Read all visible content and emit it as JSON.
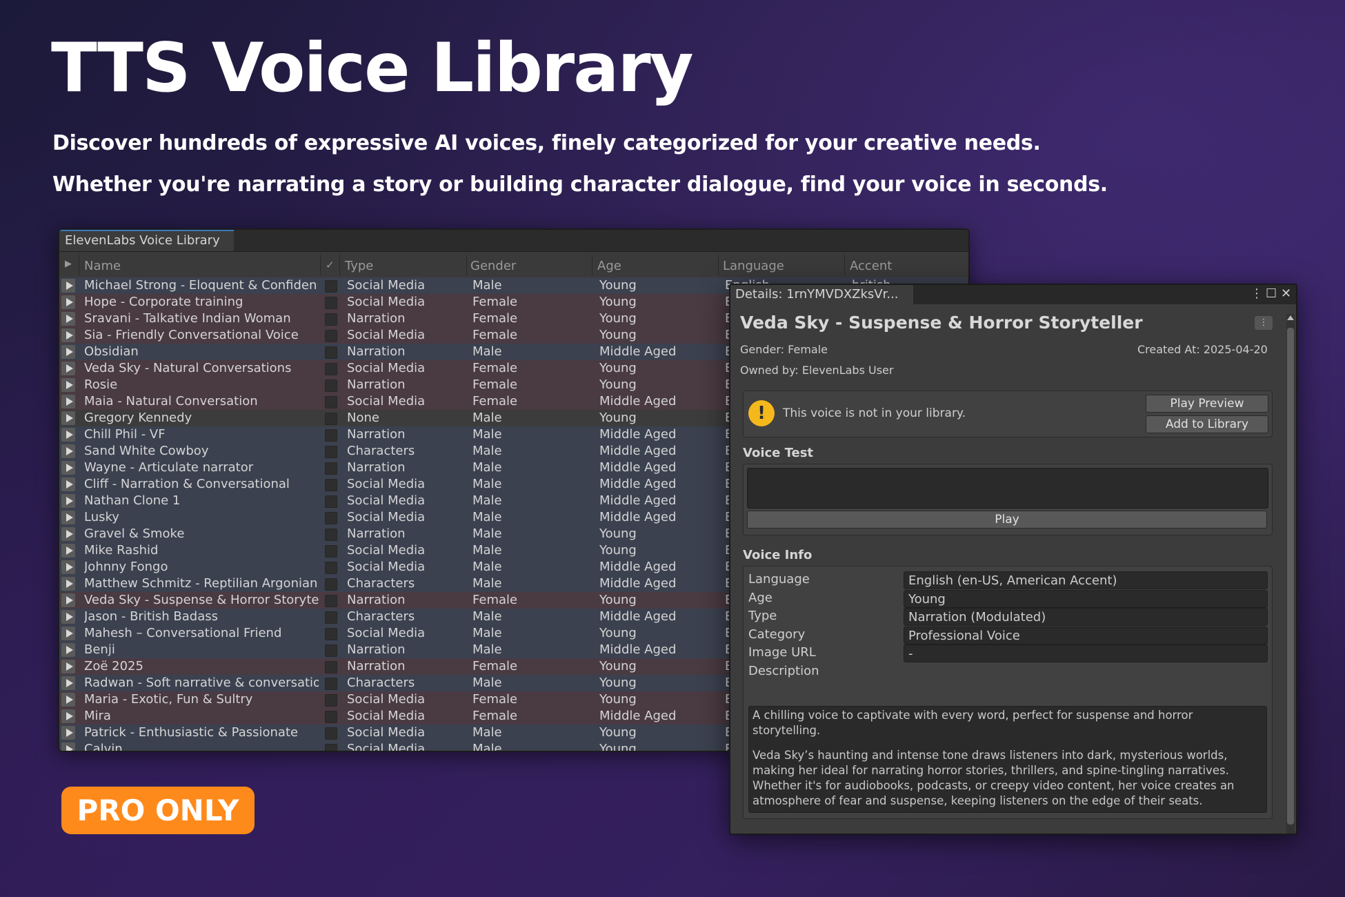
{
  "hero": {
    "title": "TTS Voice Library",
    "line1": "Discover hundreds of expressive AI voices, finely categorized for your creative needs.",
    "line2": "Whether you're narrating a story or building character dialogue, find your voice in seconds.",
    "badge": "PRO ONLY"
  },
  "library": {
    "tab_title": "ElevenLabs Voice Library",
    "columns": {
      "expand": "▶",
      "name": "Name",
      "check": "✓",
      "type": "Type",
      "gender": "Gender",
      "age": "Age",
      "language": "Language",
      "accent": "Accent"
    },
    "rows": [
      {
        "name": "Michael Strong - Eloquent & Confiden",
        "type": "Social Media",
        "gender": "Male",
        "age": "Young",
        "lang": "English",
        "acc": "british"
      },
      {
        "name": "Hope - Corporate training",
        "type": "Social Media",
        "gender": "Female",
        "age": "Young",
        "lang": "E",
        "acc": ""
      },
      {
        "name": "Sravani - Talkative Indian Woman",
        "type": "Narration",
        "gender": "Female",
        "age": "Young",
        "lang": "E",
        "acc": ""
      },
      {
        "name": "Sia - Friendly Conversational Voice",
        "type": "Social Media",
        "gender": "Female",
        "age": "Young",
        "lang": "E",
        "acc": ""
      },
      {
        "name": "Obsidian",
        "type": "Narration",
        "gender": "Male",
        "age": "Middle Aged",
        "lang": "E",
        "acc": ""
      },
      {
        "name": "Veda Sky - Natural Conversations",
        "type": "Social Media",
        "gender": "Female",
        "age": "Young",
        "lang": "E",
        "acc": ""
      },
      {
        "name": "Rosie",
        "type": "Narration",
        "gender": "Female",
        "age": "Young",
        "lang": "E",
        "acc": ""
      },
      {
        "name": "Maia - Natural Conversation",
        "type": "Social Media",
        "gender": "Female",
        "age": "Middle Aged",
        "lang": "E",
        "acc": ""
      },
      {
        "name": "Gregory Kennedy",
        "type": "None",
        "gender": "Male",
        "age": "Young",
        "lang": "E",
        "acc": ""
      },
      {
        "name": "Chill Phil - VF",
        "type": "Narration",
        "gender": "Male",
        "age": "Middle Aged",
        "lang": "E",
        "acc": ""
      },
      {
        "name": "Sand White Cowboy",
        "type": "Characters",
        "gender": "Male",
        "age": "Middle Aged",
        "lang": "E",
        "acc": ""
      },
      {
        "name": "Wayne - Articulate narrator",
        "type": "Narration",
        "gender": "Male",
        "age": "Middle Aged",
        "lang": "E",
        "acc": ""
      },
      {
        "name": "Cliff - Narration & Conversational",
        "type": "Social Media",
        "gender": "Male",
        "age": "Middle Aged",
        "lang": "E",
        "acc": ""
      },
      {
        "name": "Nathan Clone 1",
        "type": "Social Media",
        "gender": "Male",
        "age": "Middle Aged",
        "lang": "E",
        "acc": ""
      },
      {
        "name": "Lusky",
        "type": "Social Media",
        "gender": "Male",
        "age": "Middle Aged",
        "lang": "E",
        "acc": ""
      },
      {
        "name": "Gravel & Smoke",
        "type": "Narration",
        "gender": "Male",
        "age": "Young",
        "lang": "E",
        "acc": ""
      },
      {
        "name": "Mike Rashid",
        "type": "Social Media",
        "gender": "Male",
        "age": "Young",
        "lang": "E",
        "acc": ""
      },
      {
        "name": "Johnny Fongo",
        "type": "Social Media",
        "gender": "Male",
        "age": "Middle Aged",
        "lang": "E",
        "acc": ""
      },
      {
        "name": "Matthew Schmitz - Reptilian Argonian",
        "type": "Characters",
        "gender": "Male",
        "age": "Middle Aged",
        "lang": "E",
        "acc": ""
      },
      {
        "name": "Veda Sky - Suspense & Horror Storyte",
        "type": "Narration",
        "gender": "Female",
        "age": "Young",
        "lang": "E",
        "acc": ""
      },
      {
        "name": "Jason - British Badass",
        "type": "Characters",
        "gender": "Male",
        "age": "Middle Aged",
        "lang": "E",
        "acc": ""
      },
      {
        "name": "Mahesh – Conversational Friend",
        "type": "Social Media",
        "gender": "Male",
        "age": "Young",
        "lang": "E",
        "acc": ""
      },
      {
        "name": "Benji",
        "type": "Narration",
        "gender": "Male",
        "age": "Middle Aged",
        "lang": "E",
        "acc": ""
      },
      {
        "name": "Zoë 2025",
        "type": "Narration",
        "gender": "Female",
        "age": "Young",
        "lang": "E",
        "acc": ""
      },
      {
        "name": "Radwan - Soft narrative & conversatio",
        "type": "Characters",
        "gender": "Male",
        "age": "Young",
        "lang": "E",
        "acc": ""
      },
      {
        "name": "Maria -  Exotic, Fun & Sultry",
        "type": "Social Media",
        "gender": "Female",
        "age": "Young",
        "lang": "E",
        "acc": ""
      },
      {
        "name": "Mira",
        "type": "Social Media",
        "gender": "Female",
        "age": "Middle Aged",
        "lang": "E",
        "acc": ""
      },
      {
        "name": "Patrick - Enthusiastic & Passionate",
        "type": "Social Media",
        "gender": "Male",
        "age": "Young",
        "lang": "E",
        "acc": ""
      },
      {
        "name": "Calvin",
        "type": "Social Media",
        "gender": "Male",
        "age": "Young",
        "lang": "E",
        "acc": ""
      }
    ]
  },
  "details": {
    "tab_title": "Details: 1rnYMVDXZksVr...",
    "window_controls": {
      "menu": "⋮",
      "maximize": "☐",
      "close": "✕"
    },
    "title": "Veda Sky - Suspense & Horror Storyteller",
    "menu_button": "⋮",
    "gender": "Gender: Female",
    "created": "Created At: 2025-04-20",
    "owner": "Owned by: ElevenLabs User",
    "notice": {
      "icon": "!",
      "text": "This voice is not in your library.",
      "preview_button": "Play Preview",
      "add_button": "Add to Library"
    },
    "voice_test": {
      "label": "Voice Test",
      "input_value": "",
      "play_button": "Play"
    },
    "voice_info": {
      "label": "Voice Info",
      "fields": [
        {
          "label": "Language",
          "value": "English (en-US, American Accent)"
        },
        {
          "label": "Age",
          "value": "Young"
        },
        {
          "label": "Type",
          "value": "Narration (Modulated)"
        },
        {
          "label": "Category",
          "value": "Professional Voice"
        },
        {
          "label": "Image URL",
          "value": "-"
        }
      ],
      "description_label": "Description",
      "description": "A chilling voice to captivate with every word, perfect for suspense and horror storytelling.\n\nVeda Sky’s haunting and intense tone draws listeners into dark, mysterious worlds, making her ideal for narrating horror stories, thrillers, and spine-tingling narratives. Whether it's for audiobooks, podcasts, or creepy video content, her voice creates an atmosphere of fear and suspense, keeping listeners on the edge of their seats."
    }
  },
  "colors": {
    "accent_orange": "#ff8a1c",
    "warning_yellow": "#f5b81c",
    "row_male": "#3b414f",
    "row_female": "#4a3a42",
    "tab_accent": "#3a79bb"
  }
}
